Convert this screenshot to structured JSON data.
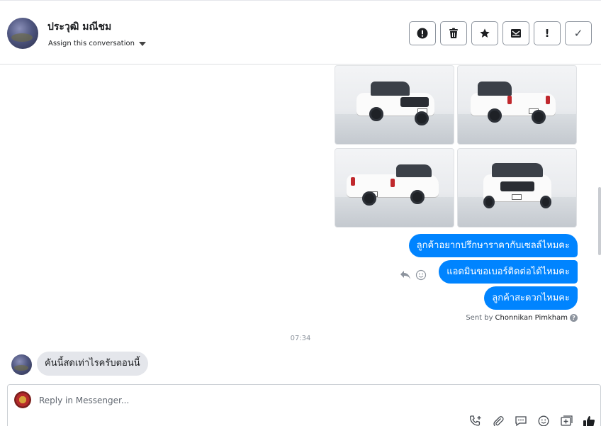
{
  "header": {
    "contact_name": "ประวุฒิ มณีชม",
    "assign_label": "Assign this conversation"
  },
  "toolbar": {
    "buttons": [
      {
        "name": "report-spam",
        "icon": "exclamation-circle-icon"
      },
      {
        "name": "delete",
        "icon": "trash-icon"
      },
      {
        "name": "star",
        "icon": "star-icon"
      },
      {
        "name": "mark-unread",
        "icon": "envelope-icon"
      },
      {
        "name": "flag",
        "icon": "exclamation-icon",
        "glyph": "!"
      },
      {
        "name": "done",
        "icon": "checkmark-icon",
        "glyph": "✓"
      }
    ]
  },
  "conversation": {
    "outgoing": [
      "ลูกค้าอยากปรึกษาราคากับเซลล์ไหมคะ",
      "แอดมินขอเบอร์ติดต่อได้ไหมคะ",
      "ลูกค้าสะดวกไหมคะ"
    ],
    "sent_by_prefix": "Sent by",
    "sent_by_name": "Chonnikan Pimkham",
    "timestamp": "07:34",
    "incoming": "คันนี้สดเท่าไรครับตอนนี้"
  },
  "composer": {
    "placeholder": "Reply in Messenger..."
  },
  "colors": {
    "accent": "#0084ff",
    "incoming_bubble": "#e4e6eb"
  }
}
